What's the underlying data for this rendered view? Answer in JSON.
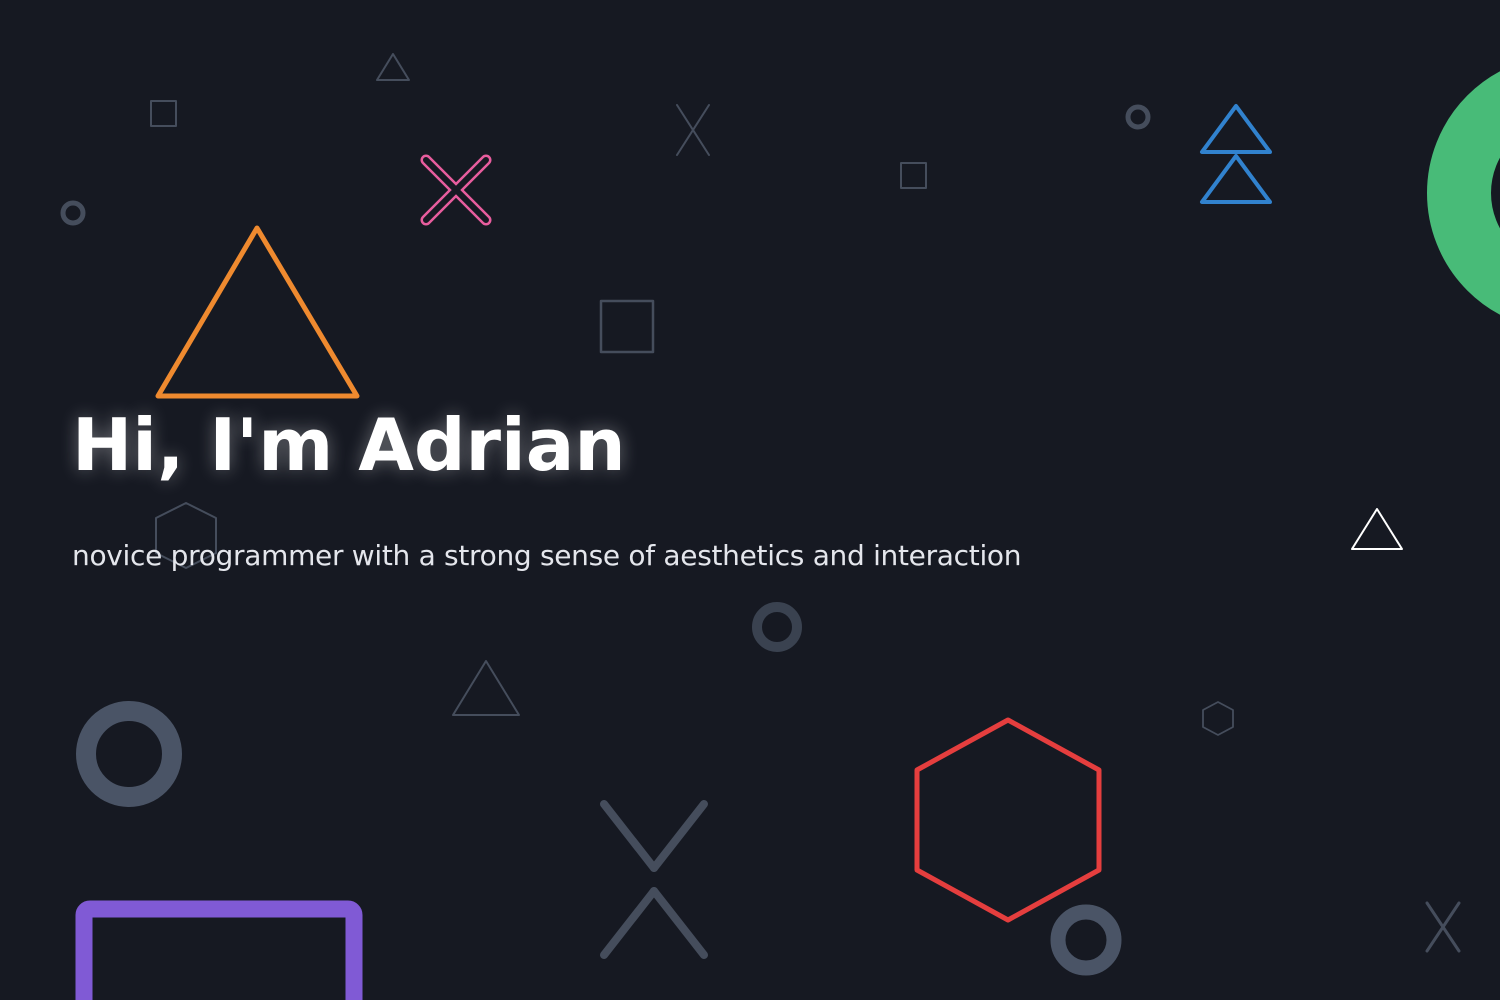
{
  "hero": {
    "title": "Hi, I'm Adrian",
    "subtitle": "novice programmer with a strong sense of aesthetics and interaction"
  },
  "colors": {
    "background": "#161922",
    "text": "#ffffff",
    "muted_shape": "#454d5c",
    "orange": "#ef8a2f",
    "pink": "#e85d9e",
    "blue": "#3182ce",
    "green": "#48bb78",
    "purple": "#805ad5",
    "red": "#e53e3e"
  },
  "icons": [
    "triangle-icon",
    "square-icon",
    "circle-icon",
    "cross-icon",
    "hexagon-icon",
    "double-triangle-icon",
    "ring-icon"
  ]
}
